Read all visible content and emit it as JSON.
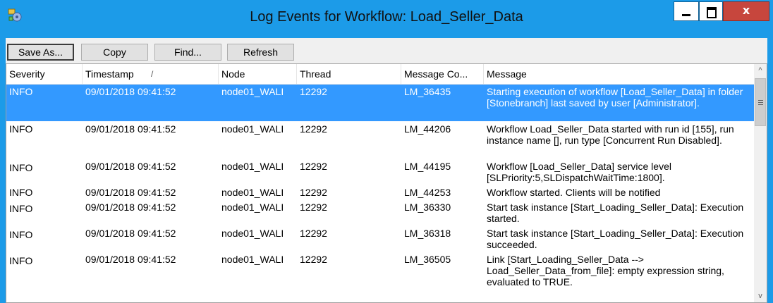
{
  "window": {
    "title": "Log Events for Workflow: Load_Seller_Data",
    "close_glyph": "x"
  },
  "toolbar": {
    "buttons": [
      "Save As...",
      "Copy",
      "Find...",
      "Refresh"
    ]
  },
  "table": {
    "columns": [
      "Severity",
      "Timestamp",
      "Node",
      "Thread",
      "Message Co...",
      "Message"
    ],
    "sort_indicator": "/",
    "rows": [
      {
        "severity": "INFO",
        "timestamp": "09/01/2018 09:41:52",
        "node": "node01_WALI",
        "thread": "12292",
        "code": "LM_36435",
        "message": "Starting execution of workflow [Load_Seller_Data] in folder [Stonebranch] last saved by user [Administrator].",
        "selected": true
      },
      {
        "severity": "INFO",
        "timestamp": "09/01/2018 09:41:52",
        "node": "node01_WALI",
        "thread": "12292",
        "code": "LM_44206",
        "message": "Workflow Load_Seller_Data started with run id [155], run instance name [], run type [Concurrent Run Disabled].",
        "selected": false
      },
      {
        "severity": "INFO",
        "timestamp": "09/01/2018 09:41:52",
        "node": "node01_WALI",
        "thread": "12292",
        "code": "LM_44195",
        "message": "Workflow [Load_Seller_Data] service level [SLPriority:5,SLDispatchWaitTime:1800].",
        "selected": false
      },
      {
        "severity": "INFO",
        "timestamp": "09/01/2018 09:41:52",
        "node": "node01_WALI",
        "thread": "12292",
        "code": "LM_44253",
        "message": "Workflow started. Clients will be notified",
        "selected": false
      },
      {
        "severity": "INFO",
        "timestamp": "09/01/2018 09:41:52",
        "node": "node01_WALI",
        "thread": "12292",
        "code": "LM_36330",
        "message": "Start task instance [Start_Loading_Seller_Data]: Execution started.",
        "selected": false
      },
      {
        "severity": "INFO",
        "timestamp": "09/01/2018 09:41:52",
        "node": "node01_WALI",
        "thread": "12292",
        "code": "LM_36318",
        "message": "Start task instance [Start_Loading_Seller_Data]: Execution succeeded.",
        "selected": false
      },
      {
        "severity": "INFO",
        "timestamp": "09/01/2018 09:41:52",
        "node": "node01_WALI",
        "thread": "12292",
        "code": "LM_36505",
        "message": "Link [Start_Loading_Seller_Data --> Load_Seller_Data_from_file]: empty expression string, evaluated to TRUE.",
        "selected": false
      }
    ]
  },
  "scrollbar": {
    "up_glyph": "^",
    "down_glyph": "v"
  },
  "colors": {
    "titlebar": "#1c9be8",
    "selection": "#3399ff",
    "close_button": "#c7463d"
  }
}
